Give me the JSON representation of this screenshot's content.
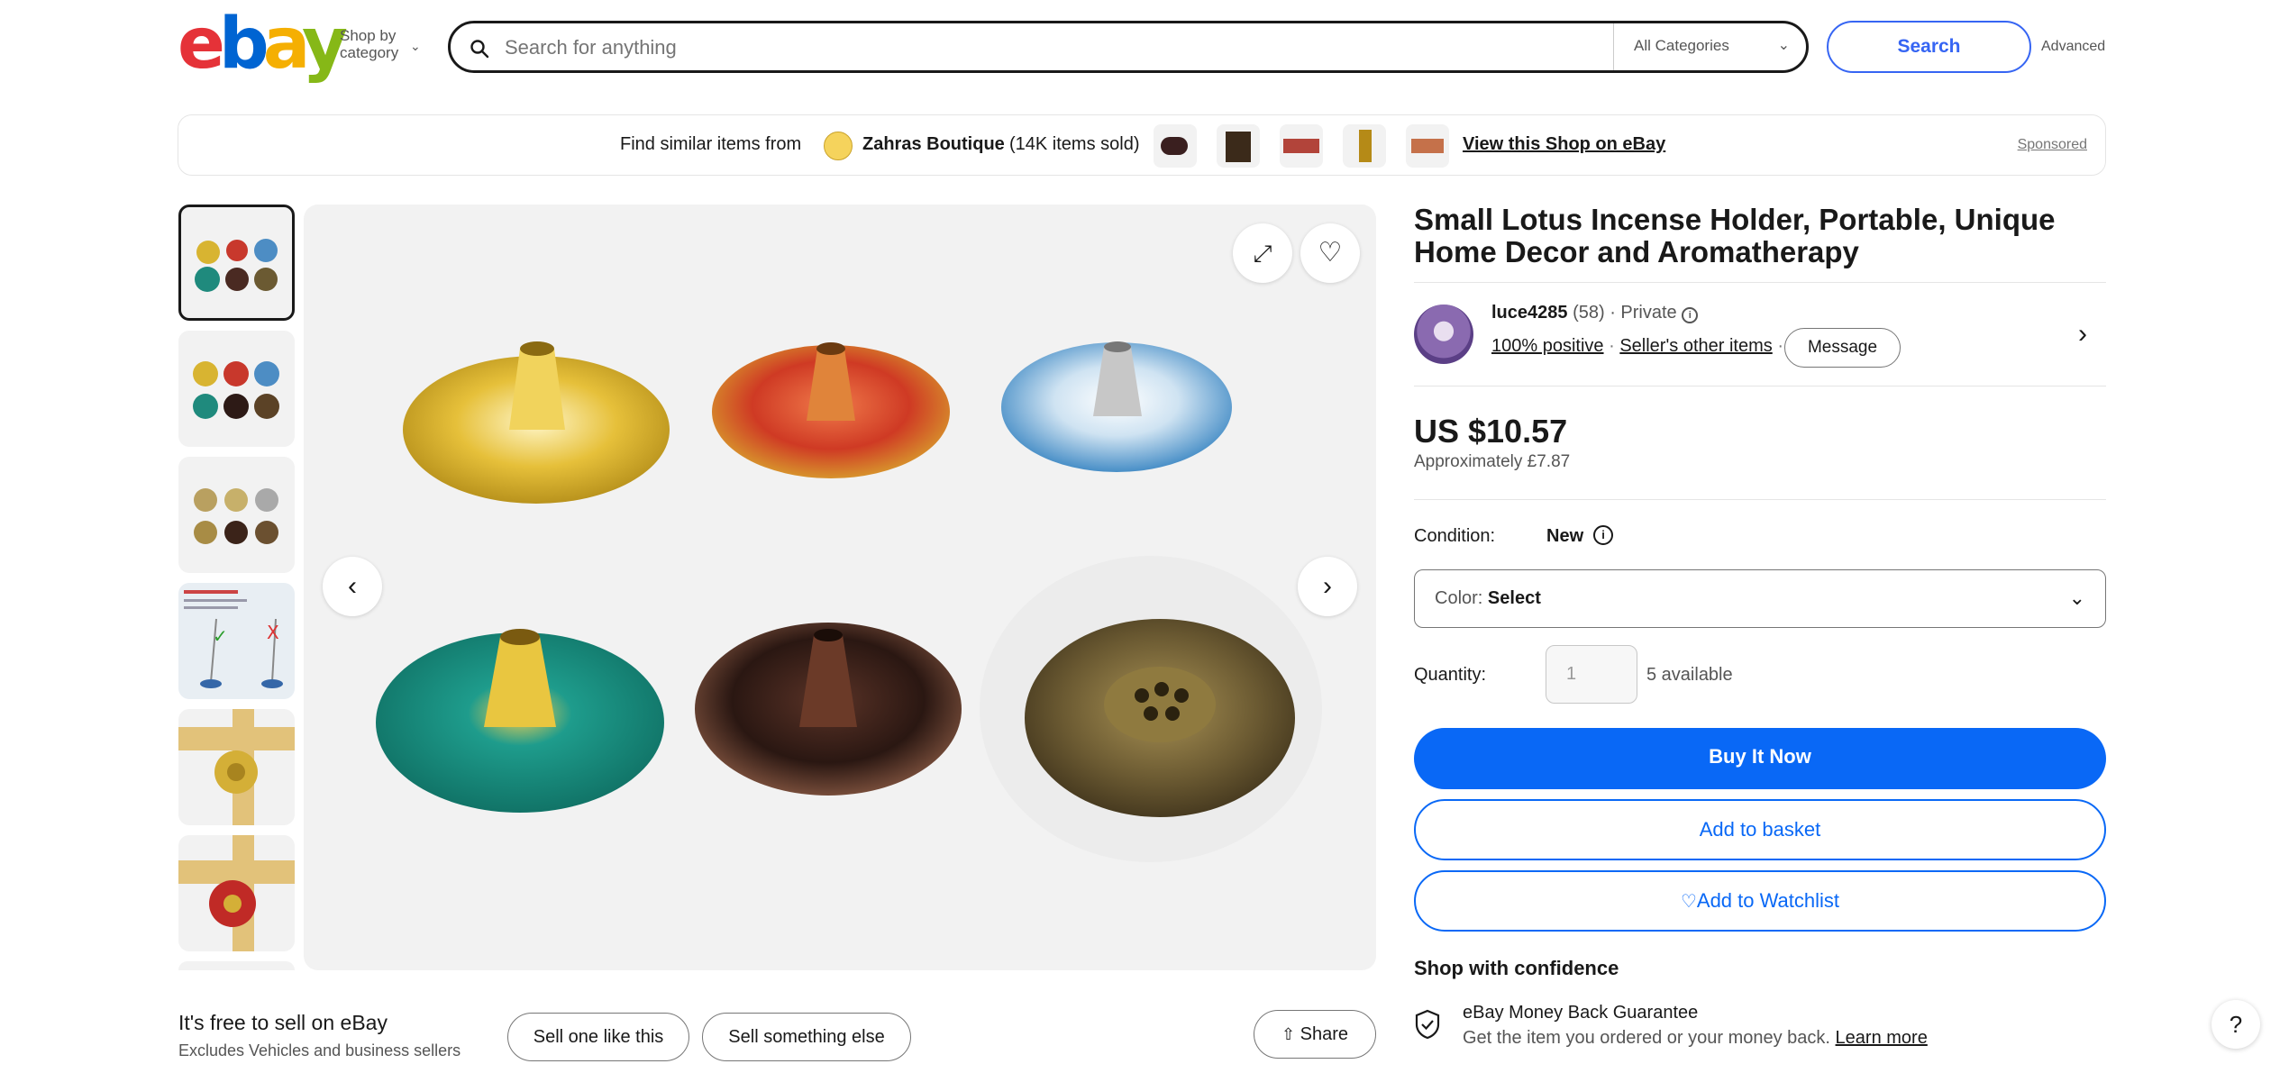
{
  "header": {
    "logo": {
      "e": "e",
      "b": "b",
      "a": "a",
      "y": "y"
    },
    "shop_by_line1": "Shop by",
    "shop_by_line2": "category",
    "search_placeholder": "Search for anything",
    "category_select": "All Categories",
    "search_button": "Search",
    "advanced_link": "Advanced"
  },
  "banner": {
    "prefix": "Find similar items from",
    "shop_name": "Zahras Boutique",
    "items_sold": "(14K items sold)",
    "view_shop": "View this Shop on eBay",
    "sponsored": "Sponsored"
  },
  "product": {
    "title": "Small Lotus Incense Holder, Portable, Unique Home Decor and Aromatherapy",
    "seller_name": "luce4285",
    "seller_count": "(58)",
    "seller_private": "· Private",
    "positive": "100% positive",
    "other_items": "Seller's other items",
    "message_button": "Message",
    "price": "US $10.57",
    "approx": "Approximately £7.87",
    "condition_label": "Condition:",
    "condition_value": "New",
    "color_label": "Color:",
    "color_value": "Select",
    "quantity_label": "Quantity:",
    "quantity_value": "1",
    "available": "5 available",
    "buy_now": "Buy It Now",
    "add_basket": "Add to basket",
    "add_watchlist": "Add to Watchlist"
  },
  "confidence": {
    "heading": "Shop with confidence",
    "mbg_title": "eBay Money Back Guarantee",
    "mbg_text": "Get the item you ordered or your money back.",
    "learn_more": "Learn more"
  },
  "sell": {
    "heading": "It's free to sell on eBay",
    "subtext": "Excludes Vehicles and business sellers",
    "sell_one": "Sell one like this",
    "sell_else": "Sell something else",
    "share": "Share"
  },
  "help": "?",
  "colors": {
    "accent": "#0968f6",
    "border": "#767676"
  }
}
